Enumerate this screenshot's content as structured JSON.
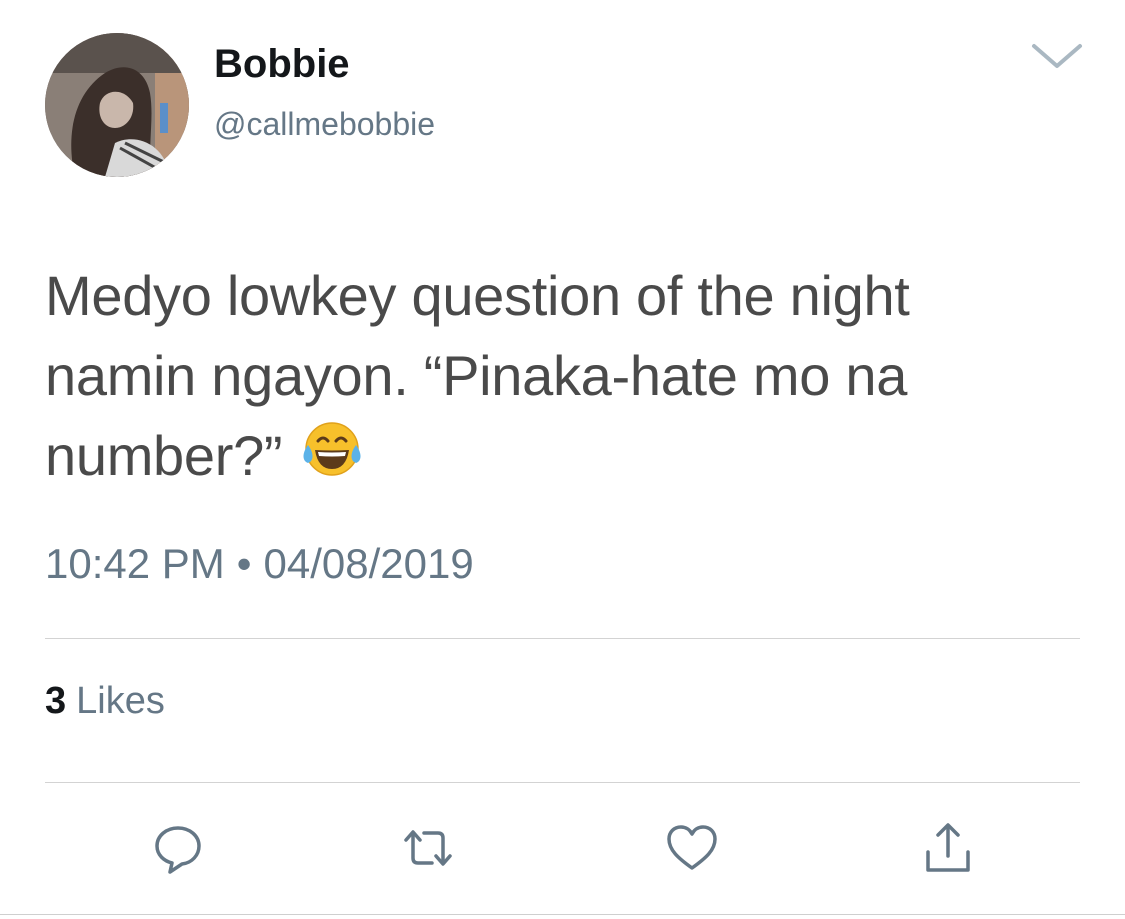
{
  "tweet": {
    "display_name": "Bobbie",
    "handle": "@callmebobbie",
    "text_lines": [
      "Medyo lowkey question of the night",
      "namin ngayon. “Pinaka-hate mo na",
      "number?”"
    ],
    "emoji": "face-with-tears-of-joy",
    "time": "10:42 PM",
    "separator": "•",
    "date": "04/08/2019",
    "likes_count": "3",
    "likes_label": "Likes"
  },
  "icons": {
    "menu": "chevron-down-icon",
    "reply": "reply-icon",
    "retweet": "retweet-icon",
    "like": "heart-icon",
    "share": "share-icon"
  },
  "colors": {
    "primary_text": "#14171a",
    "secondary_text": "#657786",
    "body_text": "#4a4a4a",
    "divider": "#d3d3d3",
    "icon": "#657786"
  }
}
